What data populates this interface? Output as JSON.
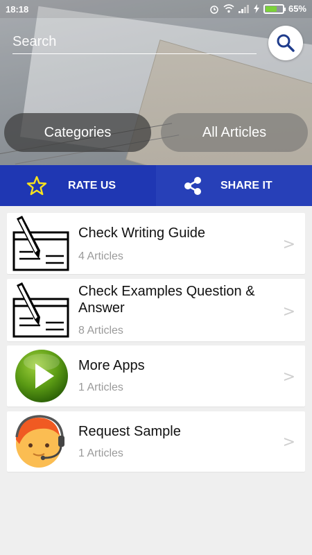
{
  "status_bar": {
    "time": "18:18",
    "battery": "65%",
    "battery_level": 0.65
  },
  "search": {
    "placeholder": "Search"
  },
  "nav_buttons": {
    "categories": "Categories",
    "all_articles": "All Articles"
  },
  "actions": {
    "rate_us": "RATE US",
    "share_it": "SHARE IT"
  },
  "items": [
    {
      "title": "Check Writing Guide",
      "count": "4 Articles",
      "icon": "check-writing-icon"
    },
    {
      "title": "Check Examples Question & Answer",
      "count": "8 Articles",
      "icon": "check-writing-icon"
    },
    {
      "title": "More Apps",
      "count": "1 Articles",
      "icon": "play-icon"
    },
    {
      "title": "Request Sample",
      "count": "1 Articles",
      "icon": "support-agent-icon"
    }
  ],
  "chevron": ">",
  "colors": {
    "action_bar": "#1f37b3",
    "search_icon": "#1f3c8c",
    "play_green": "#4f8a10"
  }
}
